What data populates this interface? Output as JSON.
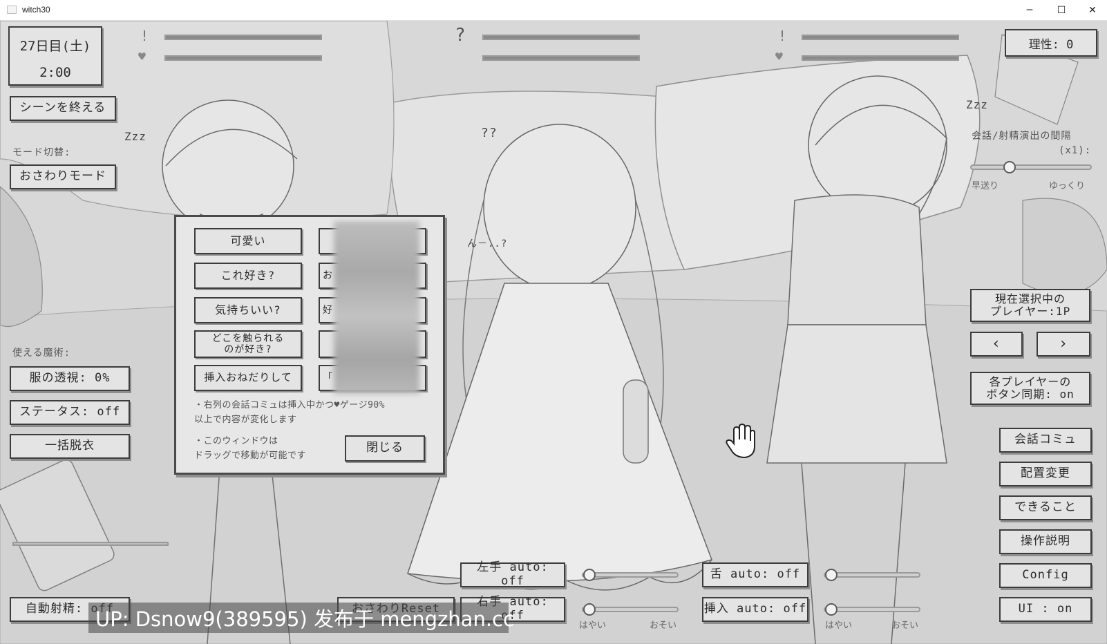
{
  "window": {
    "title": "witch30",
    "minimize": "─",
    "maximize": "☐",
    "close": "✕"
  },
  "hud": {
    "day": "27日目(土)",
    "time": "2:00",
    "reason": "理性: 0",
    "end_scene": "シーンを終える",
    "mode_label": "モード切替:",
    "mode_value": "おさわりモード",
    "magic_label": "使える魔術:",
    "magic": {
      "see_through": "服の透視: 0%",
      "status": "ステータス: off",
      "undress": "一括脱衣"
    },
    "auto_ejac": "自動射精: off"
  },
  "heroines": [
    {
      "alert": "!",
      "heart": "♥",
      "bar1": 1.0,
      "bar2": 1.0
    },
    {
      "alert": "?",
      "bar1": 1.0,
      "bar2": 1.0
    },
    {
      "alert": "!",
      "heart": "♥",
      "bar1": 1.0,
      "bar2": 1.0
    }
  ],
  "scene_texts": {
    "zzz_left": "Zzz",
    "zzz_right": "Zzz",
    "qq": "??",
    "mumble": "ん－..?"
  },
  "right_panel": {
    "interval_label_1": "会話/射精演出の間隔",
    "interval_label_2": "(x1):",
    "speed_fast": "早送り",
    "speed_slow": "ゆっくり",
    "interval_value": 0.3,
    "player_select_1": "現在選択中の",
    "player_select_2": "プレイヤー:1P",
    "prev": "‹",
    "next": "›",
    "sync_1": "各プレイヤーの",
    "sync_2": "ボタン同期: on",
    "menu": [
      "会話コミュ",
      "配置変更",
      "できること",
      "操作説明",
      "Config",
      "UI : on"
    ]
  },
  "dialog": {
    "left_buttons": [
      "可愛い",
      "これ好き?",
      "気持ちいい?",
      "どこを触られる\nのが好き?",
      "挿入おねだりして"
    ],
    "right_fragments": [
      "",
      "お",
      "好",
      "",
      "「"
    ],
    "note1": "・右列の会話コミュは挿入中かつ♥ゲージ90%以上で内容が変化します",
    "note1_a": "・右列の会話コミュは挿入中かつ♥ゲージ90%",
    "note1_b": "以上で内容が変化します",
    "note2_a": "・このウィンドウは",
    "note2_b": "ドラッグで移動が可能です",
    "close": "閉じる"
  },
  "controls": {
    "left_hand": "左手 auto: off",
    "right_hand": "右手 auto: off",
    "tongue": "舌 auto: off",
    "insert": "挿入 auto: off",
    "osawari_reset": "おさわりReset",
    "speed_fast": "はやい",
    "speed_slow": "おそい",
    "left_hand_speed": 0.0,
    "right_hand_speed": 0.0,
    "tongue_speed": 0.0,
    "insert_speed": 0.0
  },
  "watermark": "UP: Dsnow9(389595) 发布于 mengzhan.cc",
  "icons": {
    "cursor": "hand-cursor-icon"
  },
  "colors": {
    "canvas": "#d6d6d6",
    "button_bg": "#e4e4e4",
    "button_border": "#3c3c3c"
  }
}
